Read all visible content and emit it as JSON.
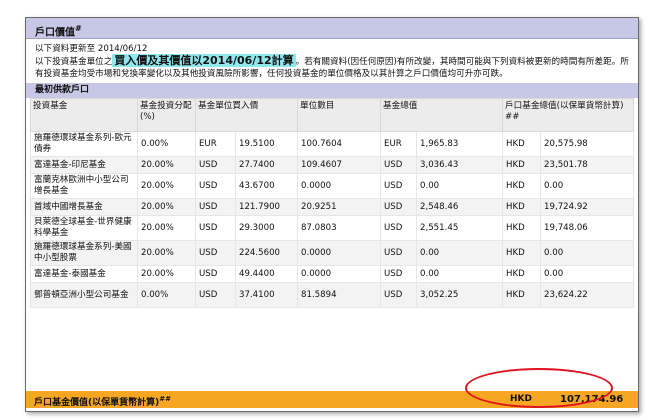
{
  "panel": {
    "title": "戶口價值",
    "title_mark": "#",
    "updated": "以下資料更新至 2014/06/12",
    "note_prefix": "以下投資基金單位之",
    "note_highlight": "買入價及其價值以2014/06/12計算",
    "note_rest": "。若有關資料(因任何原因)有所改變，其時間可能與下列資料被更新的時間有所差距。所有投資基金均受市場和兌換率變化以及其他投資風險所影響，任何投資基金的單位價格及以其計算之戶口價值均可升亦可跌。",
    "section_title": "最初供款戶口"
  },
  "table": {
    "headers": [
      "投資基金",
      "基金投資分配 (%)",
      "基金單位買入價",
      "",
      "單位數目",
      "基金總值",
      "",
      "戶口基金總值(以保單貨幣計算) ##",
      ""
    ],
    "rows": [
      [
        "施羅德環球基金系列-歐元債券",
        "0.00%",
        "EUR",
        "19.5100",
        "100.7604",
        "EUR",
        "1,965.83",
        "HKD",
        "20,575.98"
      ],
      [
        "富達基金-印尼基金",
        "20.00%",
        "USD",
        "27.7400",
        "109.4607",
        "USD",
        "3,036.43",
        "HKD",
        "23,501.78"
      ],
      [
        "富蘭克林歐洲中小型公司增長基金",
        "20.00%",
        "USD",
        "43.6700",
        "0.0000",
        "USD",
        "0.00",
        "HKD",
        "0.00"
      ],
      [
        "首域中國增長基金",
        "20.00%",
        "USD",
        "121.7900",
        "20.9251",
        "USD",
        "2,548.46",
        "HKD",
        "19,724.92"
      ],
      [
        "貝萊德全球基金-世界健康科學基金",
        "20.00%",
        "USD",
        "29.3000",
        "87.0803",
        "USD",
        "2,551.45",
        "HKD",
        "19,748.06"
      ],
      [
        "施羅德環球基金系列-美國中小型股票",
        "20.00%",
        "USD",
        "224.5600",
        "0.0000",
        "USD",
        "0.00",
        "HKD",
        "0.00"
      ],
      [
        "富達基金-泰國基金",
        "20.00%",
        "USD",
        "49.4400",
        "0.0000",
        "USD",
        "0.00",
        "HKD",
        "0.00"
      ],
      [
        "鄧普頓亞洲小型公司基金",
        "0.00%",
        "USD",
        "37.4100",
        "81.5894",
        "USD",
        "3,052.25",
        "HKD",
        "23,624.22"
      ]
    ]
  },
  "total": {
    "label": "戶口基金價值(以保單貨幣計算)",
    "label_mark": "##",
    "currency": "HKD",
    "amount": "107,174.96"
  }
}
